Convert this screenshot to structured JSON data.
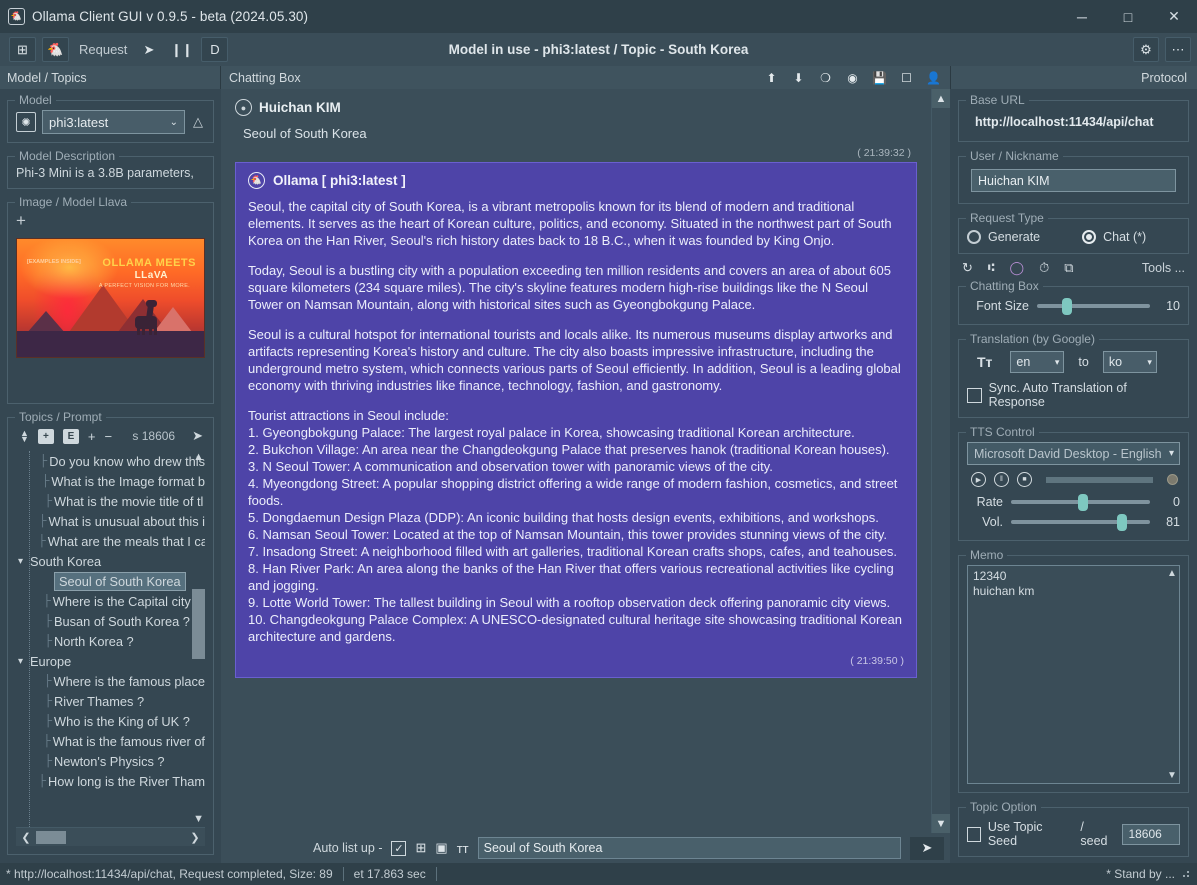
{
  "window": {
    "title": "Ollama Client GUI v 0.9.5 - beta (2024.05.30)",
    "app_icon": "llama-icon",
    "minimize": "─",
    "maximize": "□",
    "close": "✕"
  },
  "toolbar": {
    "grid_icon": "⊞",
    "llama_icon": "llama-head-icon",
    "request_label": "Request",
    "send_icon": "➤",
    "pause_icon": "❙❙",
    "debug_icon": "D",
    "center_title": "Model in use - phi3:latest / Topic - South Korea",
    "settings_icon": "⚙",
    "more_icon": "⋯"
  },
  "header": {
    "left": "Model / Topics",
    "middle": "Chatting Box",
    "right": "Protocol",
    "chat_icons": [
      "upload-icon",
      "download-icon",
      "clear-circle-icon",
      "copy-circle-icon",
      "save-icon",
      "stop-icon",
      "speak-icon"
    ]
  },
  "left_panel": {
    "model": {
      "legend": "Model",
      "refresh_icon": "✤",
      "selected": "phi3:latest",
      "chevron": "⌄",
      "up_icon": "△"
    },
    "model_description": {
      "legend": "Model Description",
      "text": "Phi-3 Mini is a 3.8B parameters,"
    },
    "image_model": {
      "legend": "Image / Model Llava",
      "plus": "+",
      "banner_title": "OLLAMA MEETS",
      "banner_sub": "LLaVA",
      "banner_tag": "A PERFECT VISION FOR MORE.",
      "banner_corner": "[EXAMPLES INSIDE]"
    },
    "topics": {
      "legend": "Topics / Prompt",
      "toolbar": {
        "sort_icon": "⌃⌄",
        "add_group_icon": "+",
        "edit_icon": "E",
        "plus_icon": "+",
        "minus_icon": "−",
        "seed_label": "s 18606",
        "send_icon": "➤"
      },
      "items": [
        {
          "label": "Do you know who drew this",
          "level": 1,
          "selected": false
        },
        {
          "label": "What is the Image format b",
          "level": 1,
          "selected": false
        },
        {
          "label": "What is the movie title of  tl",
          "level": 1,
          "selected": false
        },
        {
          "label": "What is unusual about this i",
          "level": 1,
          "selected": false
        },
        {
          "label": "What are the meals that I ca",
          "level": 1,
          "selected": false
        },
        {
          "label": "South Korea",
          "level": 0,
          "selected": false
        },
        {
          "label": "Seoul of South Korea",
          "level": 1,
          "selected": true
        },
        {
          "label": "Where is the Capital city of",
          "level": 1,
          "selected": false
        },
        {
          "label": "Busan of South Korea ?",
          "level": 1,
          "selected": false
        },
        {
          "label": "North Korea ?",
          "level": 1,
          "selected": false
        },
        {
          "label": "Europe",
          "level": 0,
          "selected": false
        },
        {
          "label": "Where is the famous place",
          "level": 1,
          "selected": false
        },
        {
          "label": "River Thames ?",
          "level": 1,
          "selected": false
        },
        {
          "label": "Who is the King of UK ?",
          "level": 1,
          "selected": false
        },
        {
          "label": "What is the famous river of",
          "level": 1,
          "selected": false
        },
        {
          "label": "Newton's Physics ?",
          "level": 1,
          "selected": false
        },
        {
          "label": "How long is the River Tham",
          "level": 1,
          "selected": false
        }
      ]
    }
  },
  "chat": {
    "user": {
      "name": "Huichan KIM",
      "message": "Seoul of South Korea",
      "timestamp": "( 21:39:32 )"
    },
    "bot": {
      "name": "Ollama [ phi3:latest ]",
      "timestamp": "( 21:39:50 )",
      "paragraphs": [
        "Seoul, the capital city of South Korea, is a vibrant metropolis known for its blend of modern and traditional elements. It serves as the heart of Korean culture, politics, and economy. Situated in the northwest part of South Korea on the Han River, Seoul's rich history dates back to 18 B.C., when it was founded by King Onjo.",
        "Today, Seoul is a bustling city with a population exceeding ten million residents and covers an area of about 605 square kilometers (234 square miles). The city's skyline features modern high-rise buildings like the N Seoul Tower on Namsan Mountain, along with historical sites such as Gyeongbokgung Palace.",
        "Seoul is a cultural hotspot for international tourists and locals alike. Its numerous museums display artworks and artifacts representing Korea's history and culture. The city also boasts impressive infrastructure, including the underground metro system, which connects various parts of Seoul efficiently. In addition, Seoul is a leading global economy with thriving industries like finance, technology, fashion, and gastronomy."
      ],
      "list_intro": "Tourist attractions in Seoul include:",
      "list_items": [
        "1. Gyeongbokgung Palace: The largest royal palace in Korea, showcasing traditional Korean architecture.",
        "2. Bukchon Village: An area near the Changdeokgung Palace that preserves hanok (traditional Korean houses).",
        "3. N Seoul Tower: A communication and observation tower with panoramic views of the city.",
        "4. Myeongdong Street: A popular shopping district offering a wide range of modern fashion, cosmetics, and street foods.",
        "5. Dongdaemun Design Plaza (DDP): An iconic building that hosts design events, exhibitions, and workshops.",
        "6. Namsan Seoul Tower: Located at the top of Namsan Mountain, this tower provides stunning views of the city.",
        "7. Insadong Street: A neighborhood filled with art galleries, traditional Korean crafts shops, cafes, and teahouses.",
        "8. Han River Park: An area along the banks of the Han River that offers various recreational activities like cycling and jogging.",
        "9. Lotte World Tower: The tallest building in Seoul with a rooftop observation deck offering panoramic city views.",
        "10. Changdeokgung Palace Complex: A UNESCO-designated cultural heritage site showcasing traditional Korean architecture and gardens."
      ]
    }
  },
  "input_bar": {
    "auto_list_label": "Auto list up  -",
    "checkbox_checked": "✓",
    "add_icon": "⊞",
    "image_icon": "▣",
    "font_icon": "ᴛт",
    "prompt_value": "Seoul of South Korea",
    "send_icon": "➤"
  },
  "right_panel": {
    "base_url": {
      "legend": "Base URL",
      "value": "http://localhost:11434/api/chat"
    },
    "user_nickname": {
      "legend": "User / Nickname",
      "value": "Huichan KIM"
    },
    "request_type": {
      "legend": "Request Type",
      "options": [
        {
          "label": "Generate",
          "selected": false
        },
        {
          "label": "Chat (*)",
          "selected": true
        }
      ]
    },
    "tools_row": {
      "refresh_icon": "↻",
      "grid_icon": "∷",
      "circle_icon": "◯",
      "timer_icon": "⏱",
      "cam_icon": "⧉",
      "label": "Tools ..."
    },
    "chatting_box": {
      "legend": "Chatting Box",
      "font_size_label": "Font Size",
      "font_size_value": "10",
      "font_size_percent": 22
    },
    "translation": {
      "legend": "Translation (by Google)",
      "icon": "Tт",
      "from": "en",
      "to_label": "to",
      "to": "ko",
      "sync_label": "Sync. Auto Translation of Response",
      "sync_checked": false
    },
    "tts": {
      "legend": "TTS Control",
      "voice": "Microsoft David Desktop - English",
      "play_icon": "▶",
      "pause_icon": "‖",
      "stop_icon": "■",
      "rate_label": "Rate",
      "rate_value": "0",
      "rate_percent": 48,
      "vol_label": "Vol.",
      "vol_value": "81",
      "vol_percent": 79
    },
    "memo": {
      "legend": "Memo",
      "lines": [
        "12340",
        "huichan km"
      ]
    },
    "topic_option": {
      "legend": "Topic Option",
      "use_seed_label": "Use Topic Seed",
      "use_seed_checked": false,
      "seed_label": "/ seed",
      "seed_value": "18606"
    }
  },
  "statusbar": {
    "left": "* http://localhost:11434/api/chat, Request completed, Size: 89",
    "elapsed": "et 17.863 sec",
    "right": "* Stand by ..."
  },
  "colors": {
    "window_bg": "#354752",
    "panel_bg": "#3b4e59",
    "titlebar": "#2f4049",
    "bubble": "#4e44a8",
    "accent": "#7ec8c0",
    "text": "#cfd8dd"
  }
}
